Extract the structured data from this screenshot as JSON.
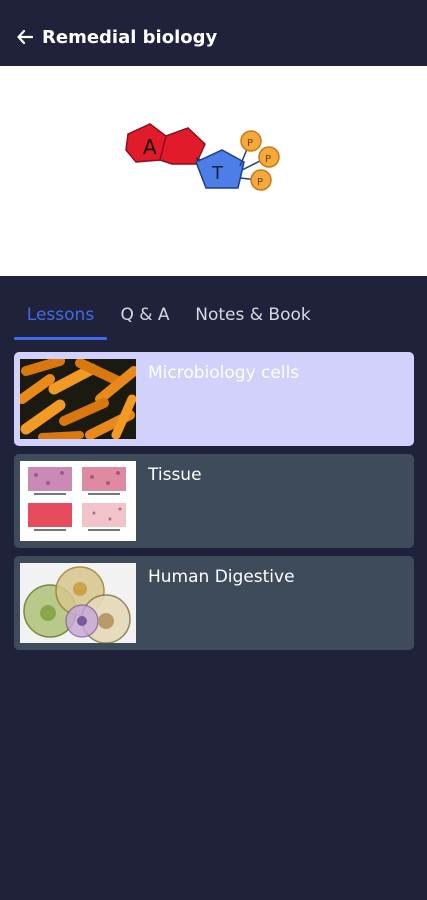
{
  "header": {
    "title": "Remedial biology",
    "back_icon": "arrow-left-icon"
  },
  "banner": {
    "image": "atp-molecule-illustration",
    "letters": [
      "A",
      "T",
      "P",
      "P",
      "P"
    ],
    "colors": {
      "adenine": "#e21b2b",
      "ribose": "#4d7de6",
      "phosphate": "#f4a93e"
    }
  },
  "tabs": [
    {
      "label": "Lessons",
      "active": true
    },
    {
      "label": "Q & A",
      "active": false
    },
    {
      "label": "Notes & Book",
      "active": false
    }
  ],
  "lessons": [
    {
      "title": "Microbiology cells",
      "thumbnail": "bacteria-thumbnail",
      "selected": true
    },
    {
      "title": "Tissue",
      "thumbnail": "tissue-types-thumbnail",
      "selected": false
    },
    {
      "title": "Human Digestive",
      "thumbnail": "cell-diagram-thumbnail",
      "selected": false
    }
  ],
  "colors": {
    "background": "#1f223a",
    "card": "#3d4b5b",
    "card_selected": "#d2d1fb",
    "accent": "#3f6be8"
  }
}
